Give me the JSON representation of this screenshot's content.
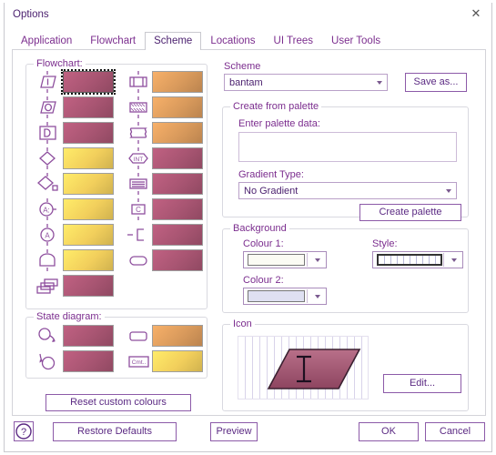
{
  "window": {
    "title": "Options",
    "close_icon": "close-icon"
  },
  "tabs": [
    {
      "label": "Application",
      "active": false
    },
    {
      "label": "Flowchart",
      "active": false
    },
    {
      "label": "Scheme",
      "active": true
    },
    {
      "label": "Locations",
      "active": false
    },
    {
      "label": "UI Trees",
      "active": false
    },
    {
      "label": "User Tools",
      "active": false
    }
  ],
  "flowchart_group": {
    "legend": "Flowchart:",
    "columns": [
      {
        "items": [
          {
            "icon": "input-parallelogram-icon",
            "color": "#a85572",
            "selected": true
          },
          {
            "icon": "output-parallelogram-icon",
            "color": "#a85572",
            "selected": false
          },
          {
            "icon": "display-d-icon",
            "color": "#a85572",
            "selected": false
          },
          {
            "icon": "decision-diamond-icon",
            "color": "#f2cf5c",
            "selected": false
          },
          {
            "icon": "decision-m-diamond-icon",
            "color": "#f2cf5c",
            "selected": false
          },
          {
            "icon": "connector-a-colon-icon",
            "color": "#f2cf5c",
            "selected": false
          },
          {
            "icon": "connector-a-icon",
            "color": "#f2cf5c",
            "selected": false
          },
          {
            "icon": "preparation-icon",
            "color": "#f2cf5c",
            "selected": false
          },
          {
            "icon": "multi-document-icon",
            "color": "#a85572",
            "selected": false
          }
        ]
      },
      {
        "items": [
          {
            "icon": "predefined-process-icon",
            "color": "#d99a5c",
            "selected": false
          },
          {
            "icon": "hatched-process-icon",
            "color": "#d99a5c",
            "selected": false
          },
          {
            "icon": "wavy-process-icon",
            "color": "#d99a5c",
            "selected": false
          },
          {
            "icon": "interrupt-int-icon",
            "color": "#a85572",
            "selected": false
          },
          {
            "icon": "stacked-lines-icon",
            "color": "#a85572",
            "selected": false
          },
          {
            "icon": "comment-c-icon",
            "color": "#a85572",
            "selected": false
          },
          {
            "icon": "branch-bracket-icon",
            "color": "#a85572",
            "selected": false
          },
          {
            "icon": "terminator-oval-icon",
            "color": "#a85572",
            "selected": false
          }
        ]
      }
    ]
  },
  "state_group": {
    "legend": "State diagram:",
    "columns": [
      {
        "items": [
          {
            "icon": "state-start-icon",
            "color": "#a85572",
            "selected": false
          },
          {
            "icon": "state-end-icon",
            "color": "#a85572",
            "selected": false
          }
        ]
      },
      {
        "items": [
          {
            "icon": "state-box-icon",
            "color": "#d99a5c",
            "selected": false
          },
          {
            "icon": "state-comment-icon",
            "color": "#f2cf5c",
            "selected": false
          }
        ]
      }
    ]
  },
  "reset_custom_colours_button": "Reset custom colours",
  "scheme": {
    "label": "Scheme",
    "value": "bantam",
    "save_as_button": "Save as..."
  },
  "create_from_palette": {
    "legend": "Create from palette",
    "palette_data_label": "Enter palette data:",
    "palette_data_value": "",
    "gradient_type_label": "Gradient Type:",
    "gradient_type_value": "No Gradient",
    "create_palette_button": "Create palette"
  },
  "background": {
    "legend": "Background",
    "colour1_label": "Colour 1:",
    "colour1_value": "#fbfbf4",
    "colour2_label": "Colour 2:",
    "colour2_value": "#dfe0f2",
    "style_label": "Style:",
    "style_value": "hatch-pattern"
  },
  "icon_group": {
    "legend": "Icon",
    "preview_shape": "parallelogram-with-text-cursor",
    "preview_color": "#a05573",
    "edit_button": "Edit..."
  },
  "footer": {
    "help_button": "?",
    "restore_defaults_button": "Restore Defaults",
    "preview_button": "Preview",
    "ok_button": "OK",
    "cancel_button": "Cancel"
  },
  "colors": {
    "accent_purple": "#7b2d8e",
    "text_purple": "#4a1f6e",
    "border_grey": "#d3d3d9"
  }
}
